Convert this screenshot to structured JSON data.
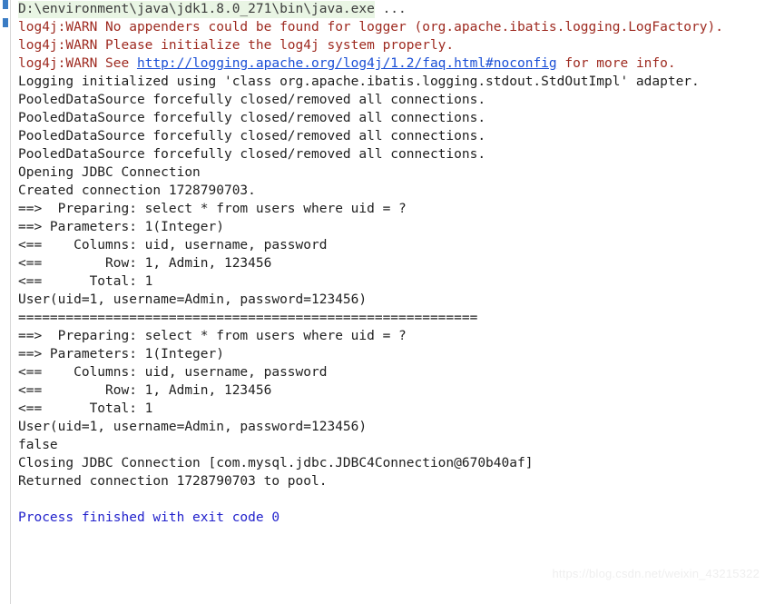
{
  "theme": {
    "background": "#ffffff",
    "default_text": "#1f1f1f",
    "command_text": "#3c3c3c",
    "command_highlight_bg": "#e9f5e4",
    "warn_text": "#9e2a20",
    "link_text": "#1a4fd6",
    "finished_text": "#2222cc",
    "gutter_marker": "#3a7cc4",
    "watermark_text": "#efefef"
  },
  "gutter": {
    "markers": [
      {
        "name": "run-marker-1"
      },
      {
        "name": "run-marker-2"
      }
    ]
  },
  "console": {
    "lines": [
      {
        "kind": "cmd",
        "name": "console-line-command",
        "highlight": "D:\\environment\\java\\jdk1.8.0_271\\bin\\java.exe",
        "text": " ..."
      },
      {
        "kind": "warn",
        "name": "console-line-log4j-warn-1",
        "text": "log4j:WARN No appenders could be found for logger (org.apache.ibatis.logging.LogFactory)."
      },
      {
        "kind": "warn",
        "name": "console-line-log4j-warn-2",
        "text": "log4j:WARN Please initialize the log4j system properly."
      },
      {
        "kind": "warn-link",
        "name": "console-line-log4j-warn-3",
        "prefix": "log4j:WARN See ",
        "link": "http://logging.apache.org/log4j/1.2/faq.html#noconfig",
        "suffix": " for more info."
      },
      {
        "kind": "info",
        "name": "console-line-logging-initialized",
        "text": "Logging initialized using 'class org.apache.ibatis.logging.stdout.StdOutImpl' adapter."
      },
      {
        "kind": "info",
        "name": "console-line-pooled-datasource-1",
        "text": "PooledDataSource forcefully closed/removed all connections."
      },
      {
        "kind": "info",
        "name": "console-line-pooled-datasource-2",
        "text": "PooledDataSource forcefully closed/removed all connections."
      },
      {
        "kind": "info",
        "name": "console-line-pooled-datasource-3",
        "text": "PooledDataSource forcefully closed/removed all connections."
      },
      {
        "kind": "info",
        "name": "console-line-pooled-datasource-4",
        "text": "PooledDataSource forcefully closed/removed all connections."
      },
      {
        "kind": "info",
        "name": "console-line-opening-jdbc-connection",
        "text": "Opening JDBC Connection"
      },
      {
        "kind": "info",
        "name": "console-line-created-connection",
        "text": "Created connection 1728790703."
      },
      {
        "kind": "info",
        "name": "console-line-preparing-1",
        "text": "==>  Preparing: select * from users where uid = ?"
      },
      {
        "kind": "info",
        "name": "console-line-parameters-1",
        "text": "==> Parameters: 1(Integer)"
      },
      {
        "kind": "info",
        "name": "console-line-columns-1",
        "text": "<==    Columns: uid, username, password"
      },
      {
        "kind": "info",
        "name": "console-line-row-1",
        "text": "<==        Row: 1, Admin, 123456"
      },
      {
        "kind": "info",
        "name": "console-line-total-1",
        "text": "<==      Total: 1"
      },
      {
        "kind": "info",
        "name": "console-line-user-result-1",
        "text": "User(uid=1, username=Admin, password=123456)"
      },
      {
        "kind": "sep",
        "name": "console-line-separator",
        "text": "=========================================================="
      },
      {
        "kind": "info",
        "name": "console-line-preparing-2",
        "text": "==>  Preparing: select * from users where uid = ?"
      },
      {
        "kind": "info",
        "name": "console-line-parameters-2",
        "text": "==> Parameters: 1(Integer)"
      },
      {
        "kind": "info",
        "name": "console-line-columns-2",
        "text": "<==    Columns: uid, username, password"
      },
      {
        "kind": "info",
        "name": "console-line-row-2",
        "text": "<==        Row: 1, Admin, 123456"
      },
      {
        "kind": "info",
        "name": "console-line-total-2",
        "text": "<==      Total: 1"
      },
      {
        "kind": "info",
        "name": "console-line-user-result-2",
        "text": "User(uid=1, username=Admin, password=123456)"
      },
      {
        "kind": "info",
        "name": "console-line-false",
        "text": "false"
      },
      {
        "kind": "info",
        "name": "console-line-closing-jdbc-connection",
        "text": "Closing JDBC Connection [com.mysql.jdbc.JDBC4Connection@670b40af]"
      },
      {
        "kind": "info",
        "name": "console-line-returned-connection",
        "text": "Returned connection 1728790703 to pool."
      },
      {
        "kind": "blank",
        "name": "console-line-blank",
        "text": " "
      },
      {
        "kind": "finished",
        "name": "console-line-process-finished",
        "text": "Process finished with exit code 0"
      }
    ]
  },
  "watermark": {
    "text": "https://blog.csdn.net/weixin_43215322"
  }
}
